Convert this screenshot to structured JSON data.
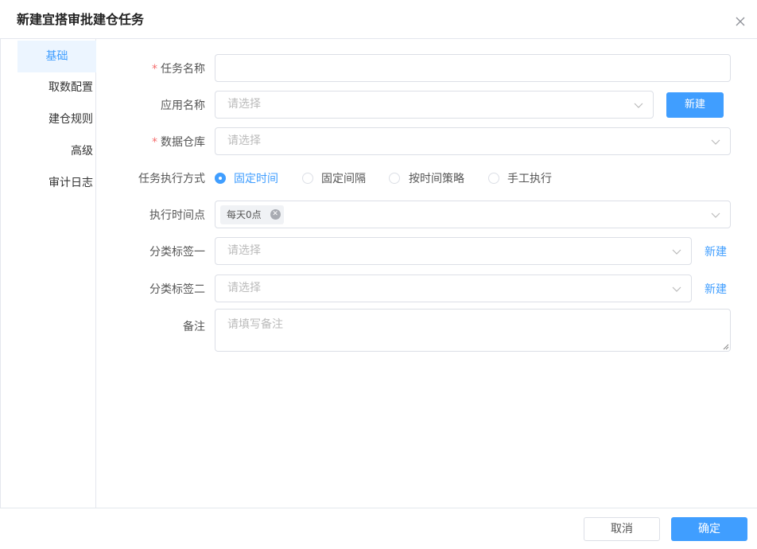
{
  "dialog": {
    "title": "新建宜搭审批建仓任务",
    "close_icon": "close-icon"
  },
  "sidebar": {
    "items": [
      {
        "label": "基础",
        "active": true
      },
      {
        "label": "取数配置"
      },
      {
        "label": "建仓规则"
      },
      {
        "label": "高级"
      },
      {
        "label": "审计日志"
      }
    ]
  },
  "form": {
    "task_name": {
      "label": "任务名称",
      "required_mark": "*",
      "value": ""
    },
    "app_name": {
      "label": "应用名称",
      "placeholder": "请选择",
      "new_button": "新建"
    },
    "data_warehouse": {
      "label": "数据仓库",
      "required_mark": "*",
      "placeholder": "请选择"
    },
    "exec_mode": {
      "label": "任务执行方式",
      "options": [
        "固定时间",
        "固定间隔",
        "按时间策略",
        "手工执行"
      ],
      "selected": "固定时间"
    },
    "exec_time": {
      "label": "执行时间点",
      "tags": [
        "每天0点"
      ]
    },
    "category1": {
      "label": "分类标签一",
      "placeholder": "请选择",
      "new_link": "新建"
    },
    "category2": {
      "label": "分类标签二",
      "placeholder": "请选择",
      "new_link": "新建"
    },
    "remark": {
      "label": "备注",
      "placeholder": "请填写备注"
    }
  },
  "footer": {
    "cancel": "取消",
    "confirm": "确定"
  },
  "colors": {
    "accent": "#409eff",
    "required": "#f56c6c",
    "border": "#dcdfe6"
  }
}
